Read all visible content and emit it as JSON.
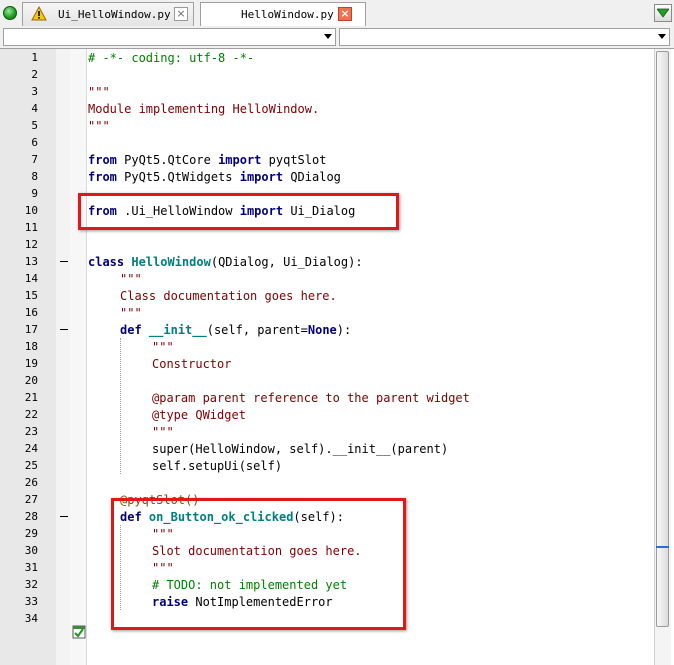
{
  "tabs": [
    {
      "label": "Ui_HelloWindow.py",
      "icon": "warning-icon",
      "active": false
    },
    {
      "label": "HelloWindow.py",
      "active": true
    }
  ],
  "combos": [
    {
      "value": ""
    },
    {
      "value": ""
    }
  ],
  "lines": [
    {
      "n": "1"
    },
    {
      "n": "2"
    },
    {
      "n": "3"
    },
    {
      "n": "4"
    },
    {
      "n": "5"
    },
    {
      "n": "6"
    },
    {
      "n": "7"
    },
    {
      "n": "8"
    },
    {
      "n": "9"
    },
    {
      "n": "10"
    },
    {
      "n": "11"
    },
    {
      "n": "12"
    },
    {
      "n": "13"
    },
    {
      "n": "14"
    },
    {
      "n": "15"
    },
    {
      "n": "16"
    },
    {
      "n": "17"
    },
    {
      "n": "18"
    },
    {
      "n": "19"
    },
    {
      "n": "20"
    },
    {
      "n": "21"
    },
    {
      "n": "22"
    },
    {
      "n": "23"
    },
    {
      "n": "24"
    },
    {
      "n": "25"
    },
    {
      "n": "26"
    },
    {
      "n": "27"
    },
    {
      "n": "28"
    },
    {
      "n": "29"
    },
    {
      "n": "30"
    },
    {
      "n": "31"
    },
    {
      "n": "32"
    },
    {
      "n": "33"
    },
    {
      "n": "34"
    }
  ],
  "code": {
    "l1": "# -*- coding: utf-8 -*-",
    "l3": "\"\"\"",
    "l4": "Module implementing HelloWindow.",
    "l5": "\"\"\"",
    "l7_kw1": "from",
    "l7_mod": " PyQt5.QtCore ",
    "l7_kw2": "import",
    "l7_name": " pyqtSlot",
    "l8_kw1": "from",
    "l8_mod": " PyQt5.QtWidgets ",
    "l8_kw2": "import",
    "l8_name": " QDialog",
    "l10_kw1": "from",
    "l10_mod": " .Ui_HelloWindow ",
    "l10_kw2": "import",
    "l10_name": " Ui_Dialog",
    "l13_kw": "class",
    "l13_name": "HelloWindow",
    "l13_rest": "(QDialog, Ui_Dialog):",
    "l14": "\"\"\"",
    "l15": "Class documentation goes here.",
    "l16": "\"\"\"",
    "l17_kw": "def",
    "l17_name": "__init__",
    "l17_rest1": "(self, parent=",
    "l17_none": "None",
    "l17_rest2": "):",
    "l18": "\"\"\"",
    "l19": "Constructor",
    "l21": "@param parent reference to the parent widget",
    "l22": "@type QWidget",
    "l23": "\"\"\"",
    "l24": "super(HelloWindow, self).__init__(parent)",
    "l25": "self.setupUi(self)",
    "l27": "@pyqtSlot()",
    "l28_kw": "def",
    "l28_name": "on_Button_ok_clicked",
    "l28_rest": "(self):",
    "l29": "\"\"\"",
    "l30": "Slot documentation goes here.",
    "l31": "\"\"\"",
    "l32": "# TODO: not implemented yet",
    "l33_kw": "raise",
    "l33_rest": " NotImplementedError"
  },
  "colors": {
    "keyword": "#00007f",
    "string": "#7f0000",
    "comment": "#007f00",
    "defname": "#007f7f",
    "highlight": "#e01818"
  }
}
